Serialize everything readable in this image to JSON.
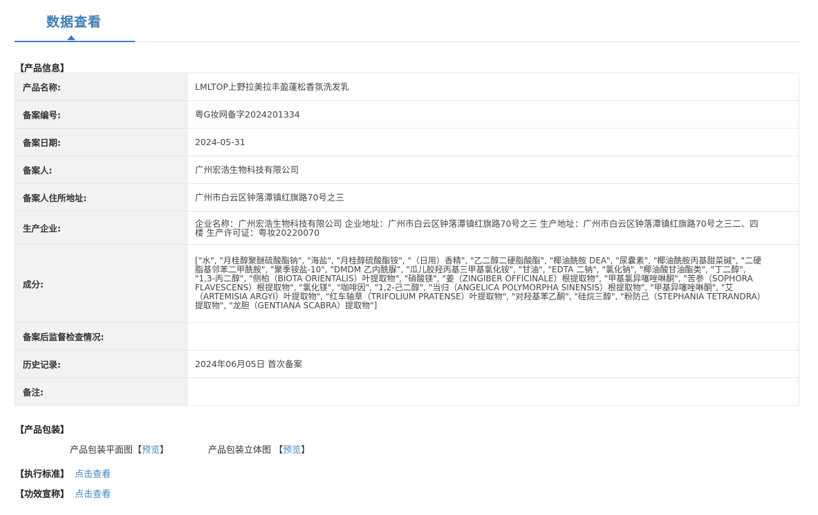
{
  "header": {
    "title": "数据查看"
  },
  "product_info": {
    "section_title": "【产品信息】",
    "rows": [
      {
        "label": "产品名称:",
        "value": "LMLTOP上野拉美拉丰盈蓬松香氛洗发乳"
      },
      {
        "label": "备案编号:",
        "value": "粤G妆网备字2024201334"
      },
      {
        "label": "备案日期:",
        "value": "2024-05-31"
      },
      {
        "label": "备案人:",
        "value": "广州宏浩生物科技有限公司"
      },
      {
        "label": "备案人住所地址:",
        "value": "广州市白云区钟落潭镇红旗路70号之三"
      },
      {
        "label": "生产企业:",
        "value": "企业名称：广州宏浩生物科技有限公司 企业地址：广州市白云区钟落潭镇红旗路70号之三 生产地址：广州市白云区钟落潭镇红旗路70号之三二、四楼 生产许可证：粤妆20220070"
      },
      {
        "label": "成分:",
        "value": "[\"水\", \"月桂醇聚醚硫酸酯钠\", \"海盐\", \"月桂醇硫酸酯铵\", \"（日用）香精\", \"乙二醇二硬脂酸酯\", \"椰油酰胺 DEA\", \"尿囊素\", \"椰油酰胺丙基甜菜碱\", \"二硬脂基邻苯二甲酰胺\", \"聚季铵盐-10\", \"DMDM 乙内酰脲\", \"瓜儿胶羟丙基三甲基氯化铵\", \"甘油\", \"EDTA 二钠\", \"氯化钠\", \"椰油酸甘油酯类\", \"丁二醇\", \"1,3-丙二醇\", \"侧柏（BIOTA ORIENTALIS）叶提取物\", \"硝酸镁\", \"姜（ZINGIBER OFFICINALE）根提取物\", \"甲基氯异噻唑啉酮\", \"苦参（SOPHORA FLAVESCENS）根提取物\", \"氯化镁\", \"咖啡因\", \"1,2-己二醇\", \"当归（ANGELICA POLYMORPHA SINENSIS）根提取物\", \"甲基异噻唑啉酮\", \"艾（ARTEMISIA ARGYI）叶提取物\", \"红车轴草（TRIFOLIUM PRATENSE）叶提取物\", \"对羟基苯乙酮\", \"硅烷三醇\", \"粉防己（STEPHANIA TETRANDRA）提取物\", \"龙胆（GENTIANA SCABRA）提取物\"]"
      },
      {
        "label": "备案后监督检查情况:",
        "value": ""
      },
      {
        "label": "历史记录:",
        "value": "2024年06月05日 首次备案"
      },
      {
        "label": "备注:",
        "value": ""
      }
    ]
  },
  "packaging": {
    "section_title": "【产品包装】",
    "flat": {
      "label": "产品包装平面图",
      "bracket_open": "【",
      "link": "预览",
      "bracket_close": "】"
    },
    "solid": {
      "label": "产品包装立体图",
      "bracket_open": "【",
      "link": "预览",
      "bracket_close": "】"
    }
  },
  "standard": {
    "label": "【执行标准】",
    "link": "点击查看"
  },
  "efficacy": {
    "label": "【功效宣称】",
    "link": "点击查看"
  },
  "colors": {
    "accent": "#3a7dbf",
    "link": "#3f86c7",
    "label_bg": "#f2f2f2",
    "table_border": "#9cb9d9"
  }
}
